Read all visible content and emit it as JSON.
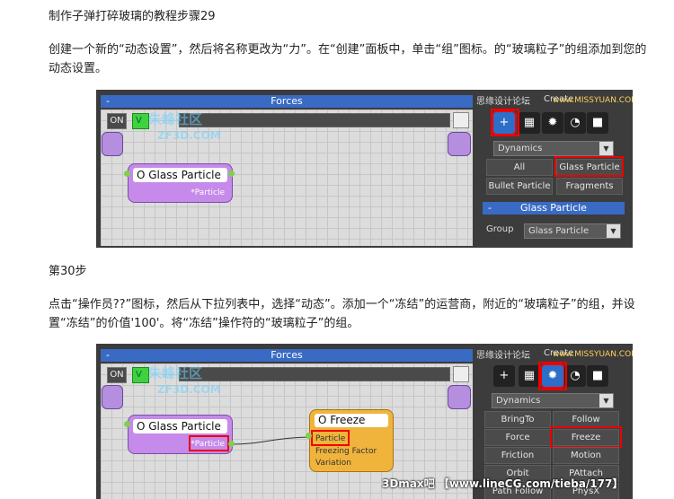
{
  "step29": {
    "title": "制作子弹打碎玻璃的教程步骤29",
    "para1": "创建一个新的“动态设置”，然后将名称更改为“力”。在“创建”面板中，单击“组”图标。的“玻璃粒子”的组添加到您的",
    "para2": "动态设置。"
  },
  "step30": {
    "title": "第30步",
    "para1": "点击“操作员??”图标，然后从下拉列表中，选择“动态”。添加一个“冻结”的运营商，附近的“玻璃粒子”的组，并设",
    "para2": "置“冻结”的价值'100'。将“冻结”操作符的“玻璃粒子”的组。"
  },
  "ui1": {
    "forces_title": "Forces",
    "on_label": "ON",
    "v_label": "V",
    "watermark1": "朱峰社区",
    "watermark2": "ZF3D.COM",
    "site_cn": "思缘设计论坛",
    "site_en": "www.MISSYUAN.COM",
    "create_label": "Create",
    "node_title": "O Glass Particle",
    "node_sub": "*Particle",
    "dropdown": "Dynamics",
    "buttons": [
      "All",
      "Glass Particle",
      "Bullet Particle",
      "Fragments"
    ],
    "rollout_minus": "-",
    "rollout_title": "Glass Particle",
    "group_label": "Group",
    "group_value": "Glass Particle"
  },
  "ui2": {
    "forces_title": "Forces",
    "on_label": "ON",
    "v_label": "V",
    "watermark1": "朱峰社区",
    "watermark2": "ZF3D.COM",
    "site_cn": "思缘设计论坛",
    "site_en": "www.MISSYUAN.COM",
    "create_label": "Create",
    "node_title": "O Glass Particle",
    "node_sub": "*Particle",
    "freeze_title": "O Freeze",
    "freeze_lines": [
      "Particle",
      "Freezing Factor",
      "Variation"
    ],
    "dropdown": "Dynamics",
    "buttons": [
      "BringTo",
      "Follow",
      "Force",
      "Freeze",
      "Friction",
      "Motion Inherit.",
      "Orbit",
      "PAttach",
      "Path Follow",
      "PhysX"
    ]
  },
  "footer": "3Dmax吧 【www.lineCG.com/tieba/177】"
}
